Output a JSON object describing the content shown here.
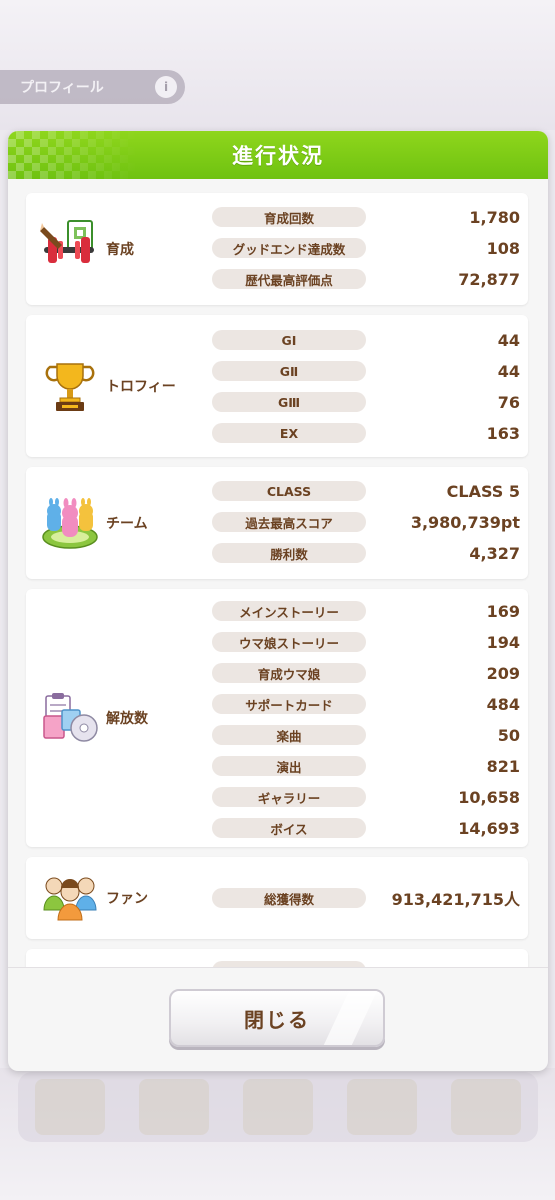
{
  "background": {
    "profile_tab_label": "プロフィール",
    "profile_tab_badge": "i"
  },
  "dialog": {
    "title": "進行状況",
    "close_label": "閉じる",
    "sections": [
      {
        "label": "育成",
        "icon": "training-icon",
        "rows": [
          {
            "label": "育成回数",
            "value": "1,780"
          },
          {
            "label": "グッドエンド達成数",
            "value": "108"
          },
          {
            "label": "歴代最高評価点",
            "value": "72,877"
          }
        ]
      },
      {
        "label": "トロフィー",
        "icon": "trophy-icon",
        "rows": [
          {
            "label": "GⅠ",
            "value": "44"
          },
          {
            "label": "GⅡ",
            "value": "44"
          },
          {
            "label": "GⅢ",
            "value": "76"
          },
          {
            "label": "EX",
            "value": "163"
          }
        ]
      },
      {
        "label": "チーム",
        "icon": "team-icon",
        "rows": [
          {
            "label": "CLASS",
            "value": "CLASS 5"
          },
          {
            "label": "過去最高スコア",
            "value": "3,980,739pt"
          },
          {
            "label": "勝利数",
            "value": "4,327"
          }
        ]
      },
      {
        "label": "解放数",
        "icon": "unlock-icon",
        "rows": [
          {
            "label": "メインストーリー",
            "value": "169"
          },
          {
            "label": "ウマ娘ストーリー",
            "value": "194"
          },
          {
            "label": "育成ウマ娘",
            "value": "209"
          },
          {
            "label": "サポートカード",
            "value": "484"
          },
          {
            "label": "楽曲",
            "value": "50"
          },
          {
            "label": "演出",
            "value": "821"
          },
          {
            "label": "ギャラリー",
            "value": "10,658"
          },
          {
            "label": "ボイス",
            "value": "14,693"
          }
        ]
      },
      {
        "label": "ファン",
        "icon": "fans-icon",
        "rows": [
          {
            "label": "総獲得数",
            "value": "913,421,715人"
          }
        ]
      }
    ]
  },
  "colors": {
    "header_green": "#7ccb14",
    "text_brown": "#6b4222",
    "pill_bg": "#ece6e2"
  }
}
